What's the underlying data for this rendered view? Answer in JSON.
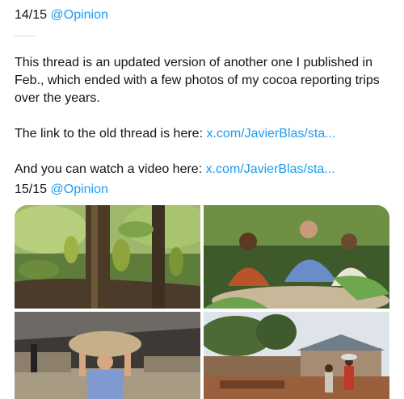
{
  "tweet14": {
    "counter": "14/15",
    "mention": "@Opinion"
  },
  "body": {
    "para1": "This thread is an updated version of another one I published in Feb., which ended with a few photos of my cocoa reporting trips over the years.",
    "para2_prefix": "The link to the old thread is here: ",
    "para2_link": "x.com/JavierBlas/sta...",
    "para3_prefix": "And you can watch a video here: ",
    "para3_link": "x.com/JavierBlas/sta..."
  },
  "tweet15": {
    "counter": "15/15",
    "mention": "@Opinion"
  },
  "colors": {
    "link": "#1d9bf0",
    "text": "#0f1419",
    "separator": "#cfd9de"
  },
  "media": [
    {
      "icon": "cocoa-pods-photo"
    },
    {
      "icon": "workers-sorting-beans-photo"
    },
    {
      "icon": "man-carrying-sack-photo"
    },
    {
      "icon": "village-drying-beans-photo"
    }
  ]
}
